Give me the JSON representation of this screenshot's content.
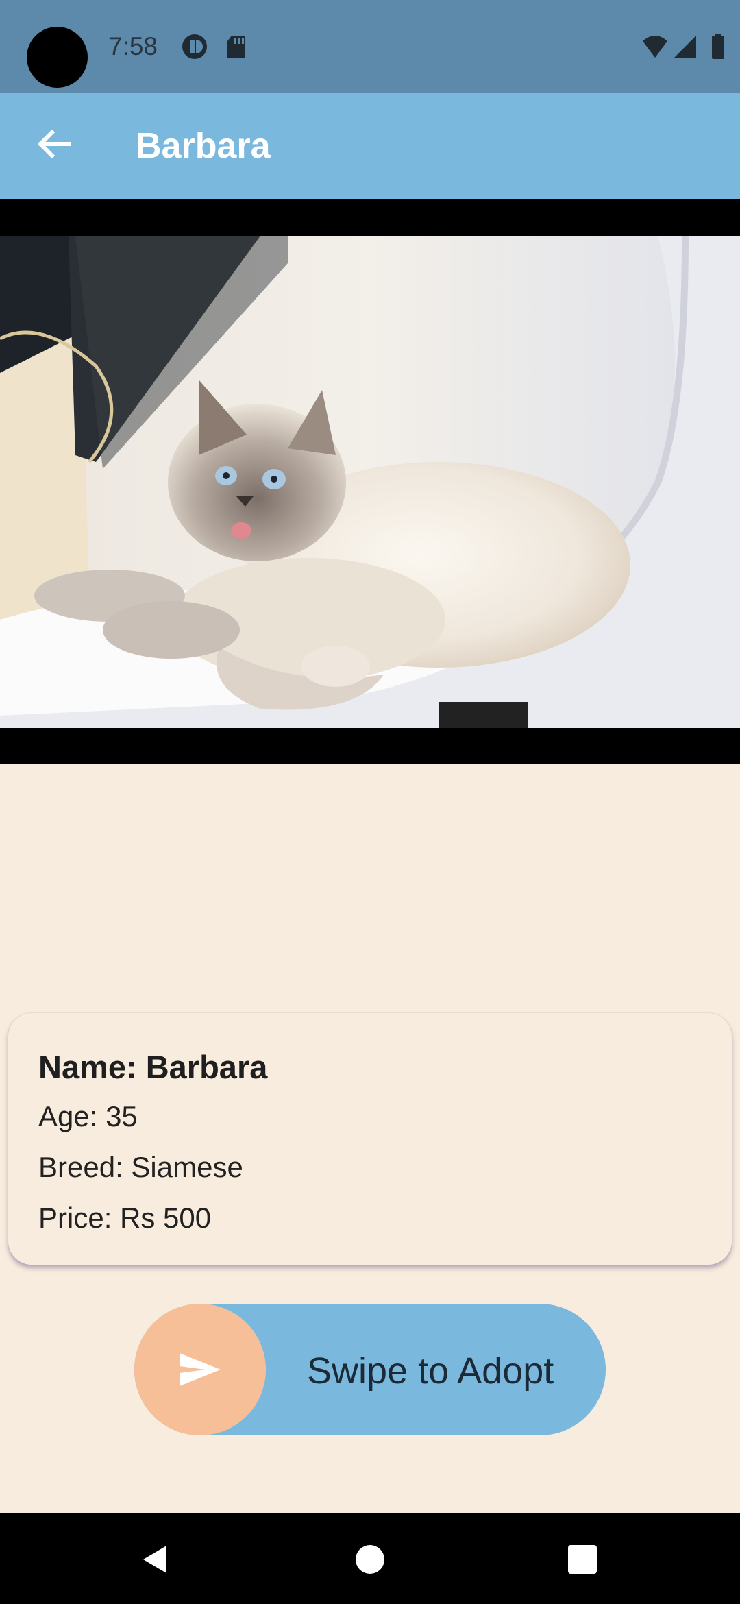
{
  "status_bar": {
    "time": "7:58"
  },
  "app_bar": {
    "title": "Barbara"
  },
  "pet": {
    "name_line": "Name: Barbara",
    "age_line": "Age: 35",
    "breed_line": "Breed: Siamese",
    "price_line": "Price: Rs 500"
  },
  "swipe": {
    "label": "Swipe to Adopt"
  },
  "colors": {
    "status_bar": "#5d89ab",
    "app_bar": "#7ab8de",
    "background": "#f7ecdd",
    "swipe_handle": "#f6bf98"
  },
  "icons": {
    "back": "arrow-left-icon",
    "send": "send-icon",
    "nav_back": "triangle-back-icon",
    "nav_home": "circle-home-icon",
    "nav_recents": "square-recents-icon"
  }
}
